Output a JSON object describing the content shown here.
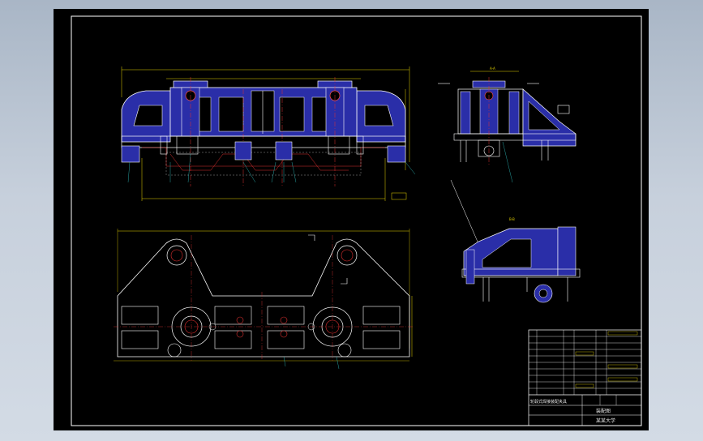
{
  "colors": {
    "background": "#000000",
    "frame": "#ffffff",
    "outline": "#ffffff",
    "fill": "#2a2ea8",
    "dimension": "#e6d400",
    "centerline": "#e03030",
    "hidden": "#ffffff",
    "leader": "#30c8c8"
  },
  "drawing": {
    "section_labels": {
      "side_view": "A-A",
      "detail_view": "B-B"
    },
    "title_block": {
      "project_title": "轮毂式焊接装配夹具",
      "sheet_name": "装配图",
      "school": "某某大学"
    }
  },
  "icons": [
    "drawing-frame",
    "title-block",
    "fixture-front-view",
    "fixture-side-view",
    "fixture-detail-view",
    "fixture-plan-view"
  ]
}
